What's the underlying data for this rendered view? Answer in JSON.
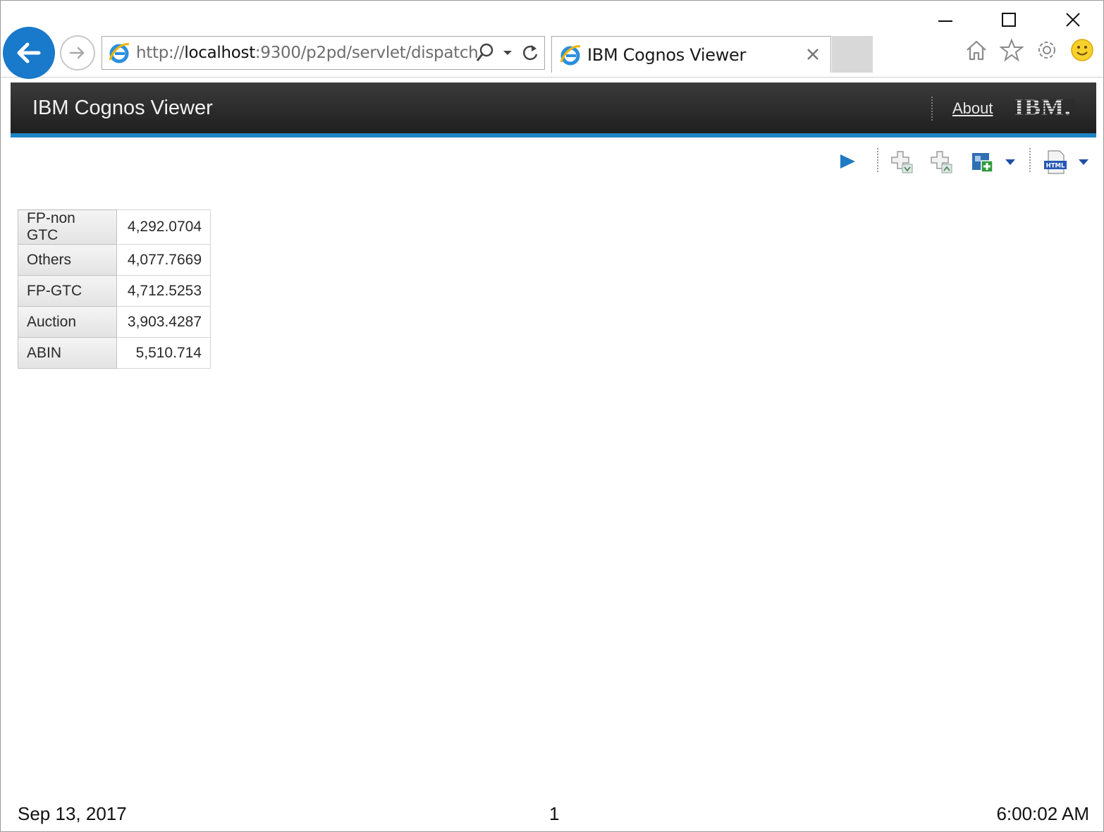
{
  "browser": {
    "url_prefix": "http://",
    "url_host": "localhost",
    "url_rest": ":9300/p2pd/servlet/dispatch",
    "tab_title": "IBM Cognos Viewer",
    "icons": {
      "back": "back-arrow-icon",
      "forward": "forward-arrow-icon",
      "search": "search-icon",
      "dropdown": "chevron-down-icon",
      "refresh": "refresh-icon",
      "close_tab": "close-icon",
      "home": "home-icon",
      "favorites": "star-icon",
      "settings": "gear-icon",
      "feedback": "smiley-icon"
    }
  },
  "header": {
    "title": "IBM Cognos Viewer",
    "about_label": "About",
    "logo_text": "IBM."
  },
  "toolbar": {
    "icons": [
      "run-icon",
      "drill-down-icon",
      "drill-up-icon",
      "add-to-report-icon",
      "html-output-icon"
    ]
  },
  "report": {
    "rows": [
      {
        "label": "FP-non GTC",
        "value": "4,292.0704"
      },
      {
        "label": "Others",
        "value": "4,077.7669"
      },
      {
        "label": "FP-GTC",
        "value": "4,712.5253"
      },
      {
        "label": "Auction",
        "value": "3,903.4287"
      },
      {
        "label": "ABIN",
        "value": "5,510.714"
      }
    ]
  },
  "footer": {
    "date": "Sep 13, 2017",
    "page": "1",
    "time": "6:00:02 AM"
  },
  "colors": {
    "accent_blue": "#1d85c5",
    "header_dark": "#2a2a2a",
    "back_button": "#1979ca"
  }
}
